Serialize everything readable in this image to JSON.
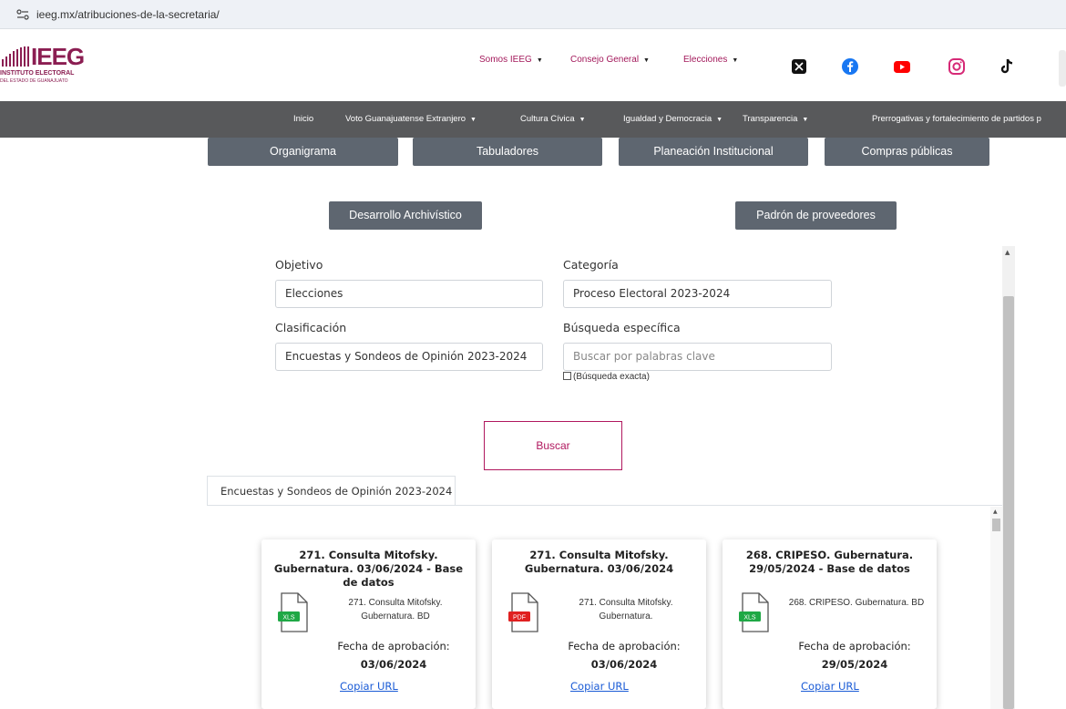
{
  "browser": {
    "url": "ieeg.mx/atribuciones-de-la-secretaria/"
  },
  "header": {
    "logo": {
      "name": "IEEG",
      "line1": "INSTITUTO ELECTORAL",
      "line2": "DEL ESTADO DE GUANAJUATO"
    },
    "top_menu": [
      {
        "label": "Somos IEEG"
      },
      {
        "label": "Consejo General"
      },
      {
        "label": "Elecciones"
      }
    ],
    "social_icons": [
      "x-icon",
      "facebook-icon",
      "youtube-icon",
      "instagram-icon",
      "tiktok-icon"
    ]
  },
  "main_nav": [
    {
      "label": "Inicio",
      "dropdown": false
    },
    {
      "label": "Voto Guanajuatense Extranjero",
      "dropdown": true
    },
    {
      "label": "Cultura Cívica",
      "dropdown": true
    },
    {
      "label": "Igualdad y Democracia",
      "dropdown": true
    },
    {
      "label": "Transparencia",
      "dropdown": true
    },
    {
      "label": "Prerrogativas y fortalecimiento de partidos p",
      "dropdown": false
    }
  ],
  "section_buttons": [
    "Organigrama",
    "Tabuladores",
    "Planeación Institucional",
    "Compras públicas"
  ],
  "secondary_buttons": [
    "Desarrollo Archivístico",
    "Padrón de proveedores"
  ],
  "search": {
    "objetivo": {
      "label": "Objetivo",
      "value": "Elecciones"
    },
    "categoria": {
      "label": "Categoría",
      "value": "Proceso Electoral 2023-2024"
    },
    "clasificacion": {
      "label": "Clasificación",
      "value": "Encuestas y Sondeos de Opinión 2023-2024"
    },
    "busqueda": {
      "label": "Búsqueda específica",
      "placeholder": "Buscar por palabras clave"
    },
    "exact_label": "(Búsqueda exacta)",
    "button": "Buscar"
  },
  "results": {
    "tab_label": "Encuestas y Sondeos de Opinión 2023-2024",
    "cards": [
      {
        "title": "271. Consulta Mitofsky. Gubernatura. 03/06/2024 - Base de datos",
        "file_type": "XLS",
        "file_color": "#1fa845",
        "file_name": "271. Consulta Mitofsky. Gubernatura. BD",
        "approval_label": "Fecha de aprobación:",
        "approval_date": "03/06/2024",
        "link": "Copiar URL"
      },
      {
        "title": "271. Consulta Mitofsky. Gubernatura. 03/06/2024",
        "file_type": "PDF",
        "file_color": "#e02020",
        "file_name": "271. Consulta Mitofsky. Gubernatura.",
        "approval_label": "Fecha de aprobación:",
        "approval_date": "03/06/2024",
        "link": "Copiar URL"
      },
      {
        "title": "268. CRIPESO. Gubernatura. 29/05/2024 - Base de datos",
        "file_type": "XLS",
        "file_color": "#1fa845",
        "file_name": "268. CRIPESO. Gubernatura. BD",
        "approval_label": "Fecha de aprobación:",
        "approval_date": "29/05/2024",
        "link": "Copiar URL"
      }
    ]
  },
  "colors": {
    "brand": "#8b1e52",
    "accent": "#b0175e",
    "nav_bg": "#58595b",
    "button_bg": "#5e6670",
    "link": "#1a5bd6"
  }
}
